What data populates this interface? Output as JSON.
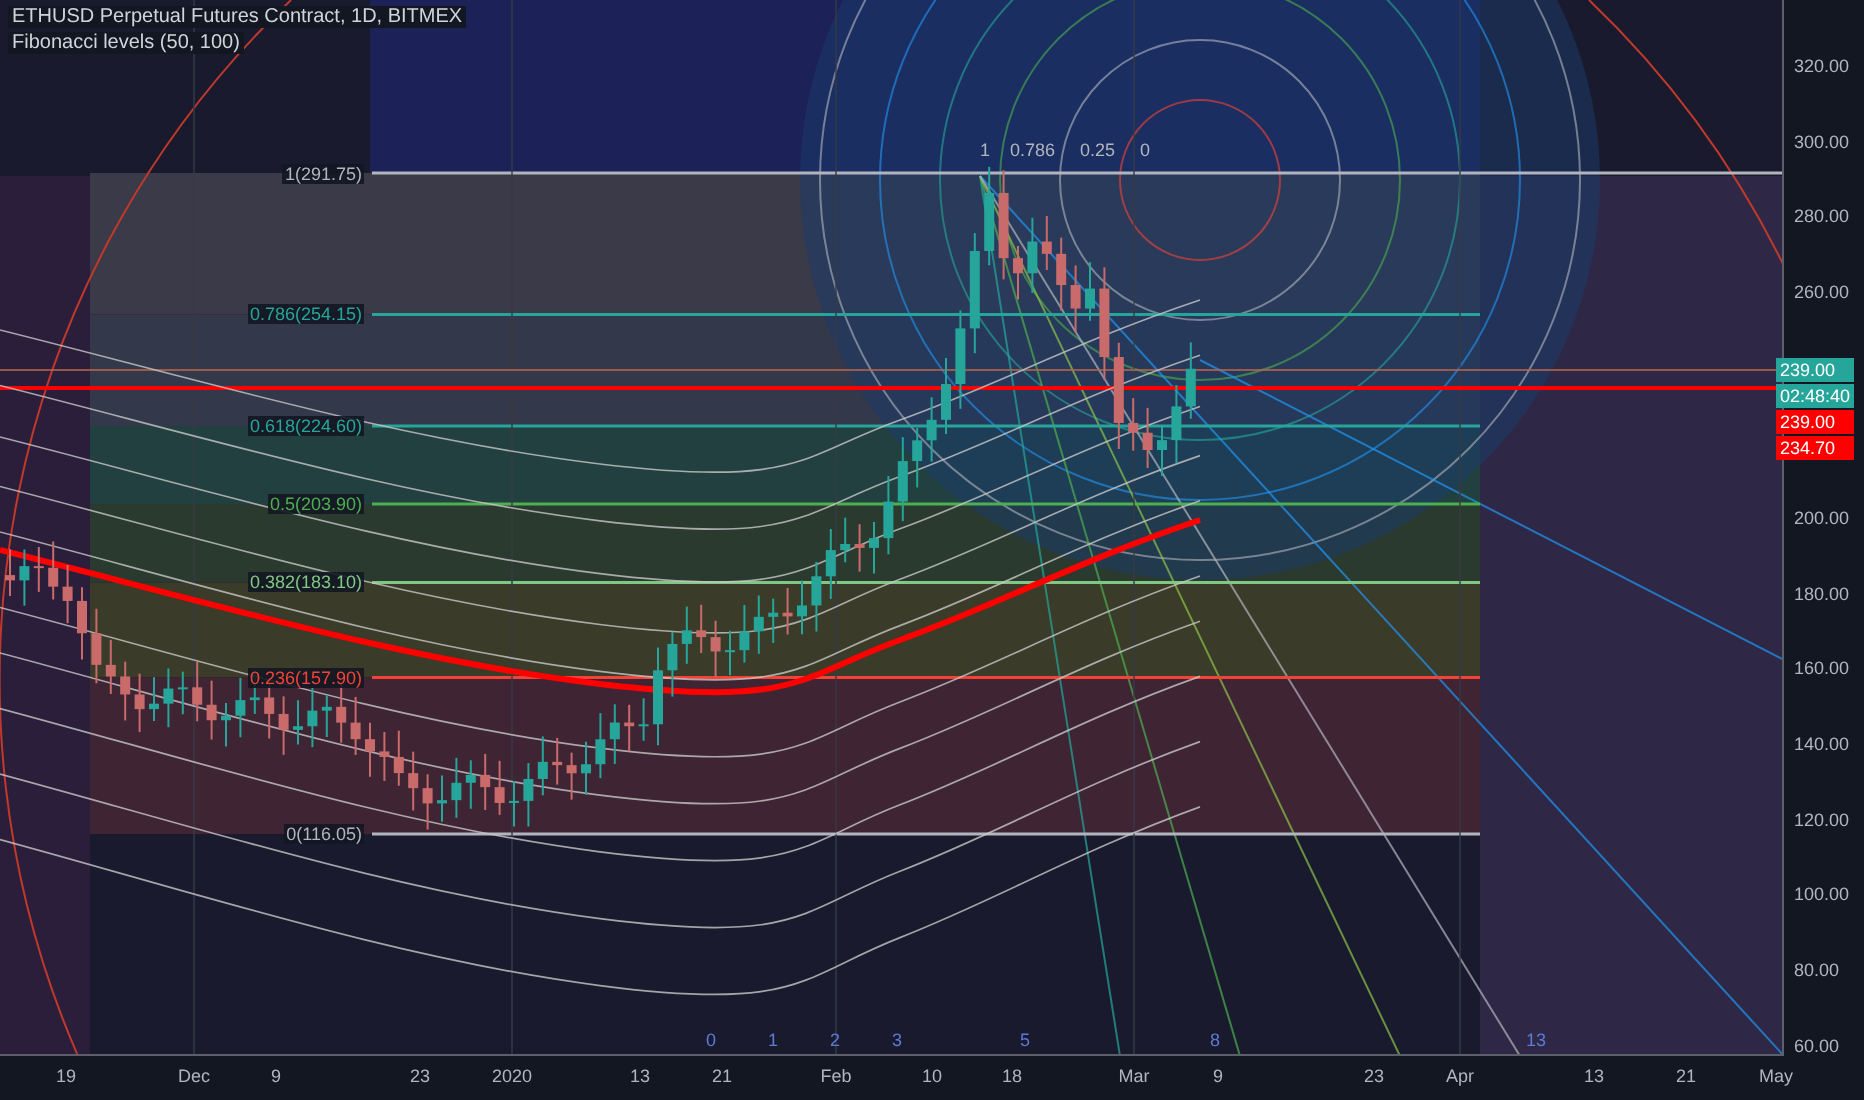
{
  "header": {
    "title": "ETHUSD Perpetual Futures Contract, 1D, BITMEX",
    "indicator": "Fibonacci levels (50, 100)"
  },
  "fib_levels": [
    {
      "label": "1(291.75)"
    },
    {
      "label": "0.786(254.15)"
    },
    {
      "label": "0.618(224.60)"
    },
    {
      "label": "0.5(203.90)"
    },
    {
      "label": "0.382(183.10)"
    },
    {
      "label": "0.236(157.90)"
    },
    {
      "label": "0(116.05)"
    }
  ],
  "fan_labels": [
    "1",
    "0.786",
    "0.25",
    "0"
  ],
  "time_zone_labels": [
    "0",
    "1",
    "2",
    "3",
    "5",
    "8",
    "13"
  ],
  "price_axis": [
    "320.00",
    "300.00",
    "280.00",
    "260.00",
    "200.00",
    "180.00",
    "160.00",
    "140.00",
    "120.00",
    "100.00",
    "80.00",
    "60.00"
  ],
  "price_tags": [
    {
      "text": "239.00",
      "color": "#26a69a"
    },
    {
      "text": "02:48:40",
      "color": "#26a69a"
    },
    {
      "text": "239.00",
      "color": "#ff0000"
    },
    {
      "text": "234.70",
      "color": "#ff0000"
    }
  ],
  "date_axis": [
    "19",
    "Dec",
    "9",
    "23",
    "2020",
    "13",
    "21",
    "Feb",
    "10",
    "18",
    "Mar",
    "9",
    "23",
    "Apr",
    "13",
    "21",
    "May"
  ]
}
